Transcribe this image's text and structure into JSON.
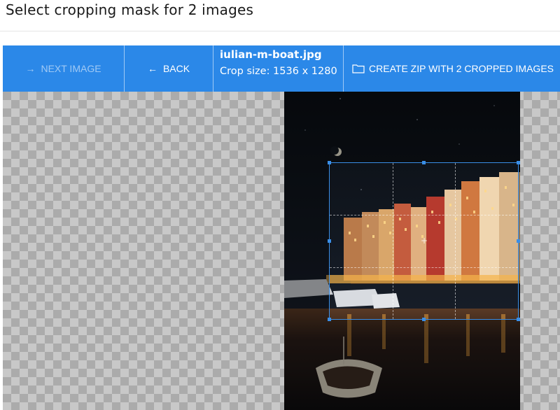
{
  "page": {
    "title": "Select cropping mask for 2 images"
  },
  "toolbar": {
    "next_label": "NEXT IMAGE",
    "next_icon": "arrow-right-icon",
    "back_label": "BACK",
    "back_icon": "arrow-left-icon",
    "file_name": "iulian-m-boat.jpg",
    "crop_size": "Crop size: 1536 x 1280",
    "zip_label": "CREATE ZIP WITH 2 CROPPED IMAGES",
    "zip_icon": "folder-icon"
  },
  "colors": {
    "accent": "#2b88e8",
    "crop_border": "#3a8ee6"
  }
}
